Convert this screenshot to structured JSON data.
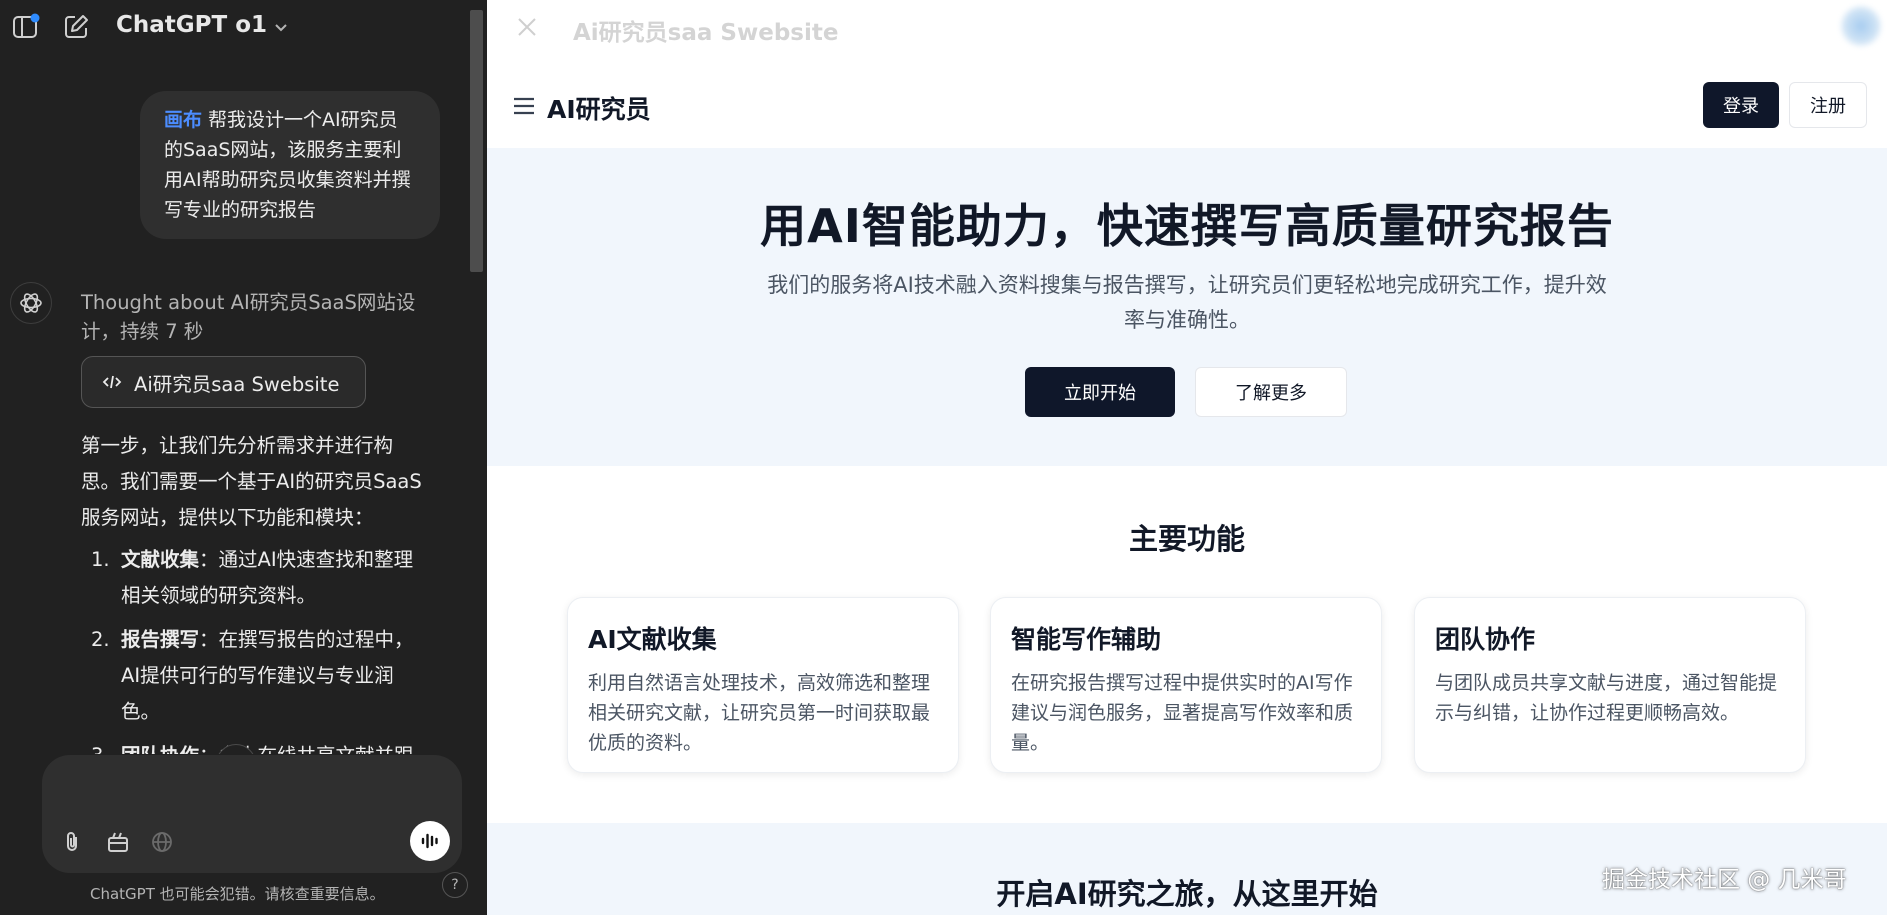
{
  "chat": {
    "model_name": "ChatGPT o1",
    "user_message": {
      "tag": "画布",
      "text": "帮我设计一个AI研究员的SaaS网站，该服务主要利用AI帮助研究员收集资料并撰写专业的研究报告"
    },
    "thought": "Thought about AI研究员SaaS网站设计，持续 7 秒",
    "canvas_chip_label": "Ai研究员saa Swebsite",
    "answer_intro": "第一步，让我们先分析需求并进行构思。我们需要一个基于AI的研究员SaaS服务网站，提供以下功能和模块：",
    "answer_items": [
      {
        "num": "1.",
        "title": "文献收集",
        "text": "：通过AI快速查找和整理相关领域的研究资料。"
      },
      {
        "num": "2.",
        "title": "报告撰写",
        "text": "：在撰写报告的过程中，AI提供可行的写作建议与专业润色。"
      },
      {
        "num": "3.",
        "title": "团队协作",
        "text": "：多人在线共享文献并跟"
      }
    ],
    "composer_placeholder": "",
    "disclaimer": "ChatGPT 也可能会犯错。请核查重要信息。",
    "help_label": "?"
  },
  "canvas": {
    "title": "Ai研究员saa Swebsite",
    "site": {
      "brand": "AI研究员",
      "login_label": "登录",
      "register_label": "注册",
      "hero_title": "用AI智能助力，快速撰写高质量研究报告",
      "hero_subtitle": "我们的服务将AI技术融入资料搜集与报告撰写，让研究员们更轻松地完成研究工作，提升效率与准确性。",
      "start_label": "立即开始",
      "learn_label": "了解更多",
      "features_title": "主要功能",
      "features": [
        {
          "title": "AI文献收集",
          "desc": "利用自然语言处理技术，高效筛选和整理相关研究文献，让研究员第一时间获取最优质的资料。"
        },
        {
          "title": "智能写作辅助",
          "desc": "在研究报告撰写过程中提供实时的AI写作建议与润色服务，显著提高写作效率和质量。"
        },
        {
          "title": "团队协作",
          "desc": "与团队成员共享文献与进度，通过智能提示与纠错，让协作过程更顺畅高效。"
        }
      ],
      "cta_title": "开启AI研究之旅，从这里开始"
    },
    "watermark": "掘金技术社区 @ 几米哥"
  },
  "colors": {
    "chat_bg": "#212121",
    "bubble_bg": "#2f2f2f",
    "accent_blue": "#4c8dff",
    "primary_dark": "#0f172a",
    "hero_bg": "#f1f6fc"
  },
  "icons": {
    "sidebar_toggle": "sidebar-toggle-icon",
    "new_chat": "edit-icon",
    "dropdown": "chevron-down-icon",
    "assistant": "openai-logo-icon",
    "code": "code-icon",
    "arrow_down": "arrow-down-icon",
    "attach": "paperclip-icon",
    "tools": "toolbox-icon",
    "globe": "globe-icon",
    "voice": "voice-wave-icon",
    "close": "close-icon",
    "menu": "hamburger-menu-icon"
  }
}
